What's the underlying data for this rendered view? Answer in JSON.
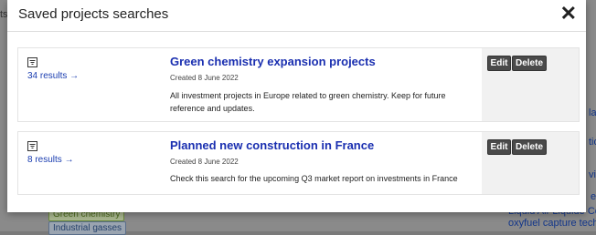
{
  "background": {
    "right_links": [
      "lac",
      "tion",
      "vin",
      "e"
    ],
    "bottom_right_link_1": "Liquid Air Liquide Com",
    "bottom_right_link_2": "oxyfuel capture techno",
    "tag_green": "Green chemistry",
    "tag_industrial": "Industrial gasses",
    "left_fragment": "ts"
  },
  "modal": {
    "title": "Saved projects searches",
    "close_icon": "close-icon"
  },
  "searches": [
    {
      "results": "34 results →",
      "title": "Green chemistry expansion projects",
      "created": "Created 8 June 2022",
      "description": "All investment projects in Europe related to green chemistry. Keep for future reference and updates.",
      "edit": "Edit",
      "delete": "Delete"
    },
    {
      "results": "8 results →",
      "title": "Planned new construction in France",
      "created": "Created 8 June 2022",
      "description": "Check this search for the upcoming Q3 market report on investments in France",
      "edit": "Edit",
      "delete": "Delete"
    }
  ]
}
